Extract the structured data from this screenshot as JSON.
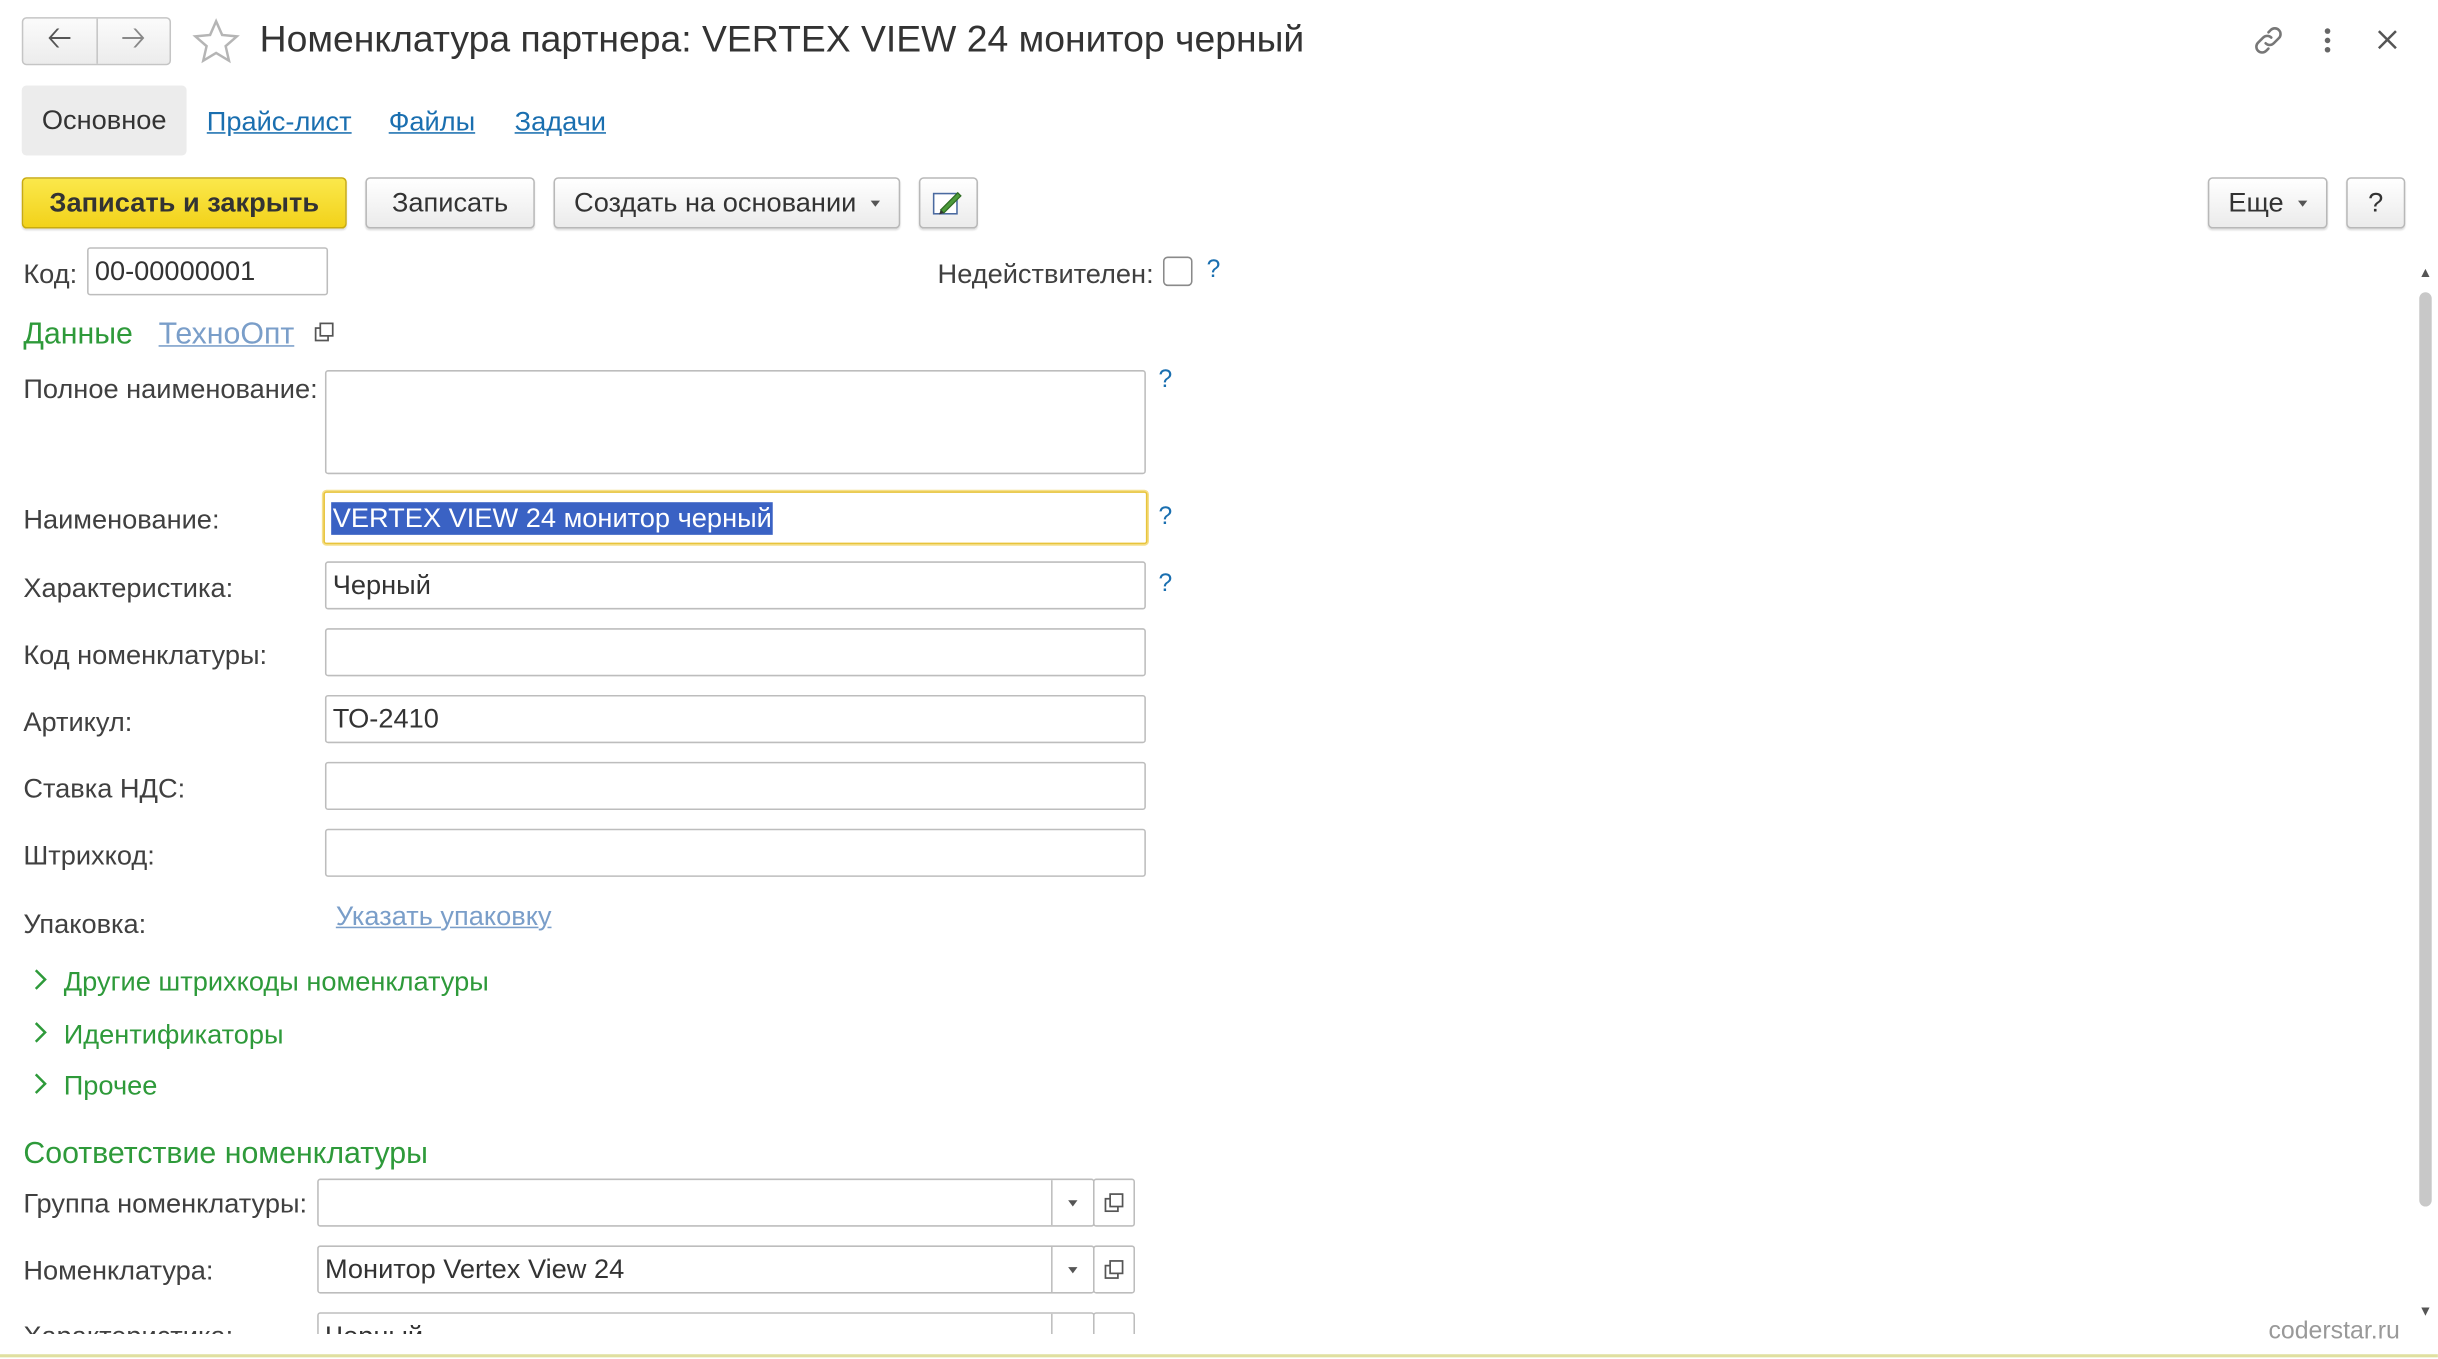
{
  "header": {
    "title": "Номенклатура партнера: VERTEX VIEW 24 монитор черный"
  },
  "tabs": [
    "Основное",
    "Прайс-лист",
    "Файлы",
    "Задачи"
  ],
  "toolbar": {
    "save_close": "Записать и закрыть",
    "save": "Записать",
    "create_based": "Создать на основании",
    "more": "Еще",
    "help": "?"
  },
  "form": {
    "code_label": "Код:",
    "code_value": "00-00000001",
    "invalid_label": "Недействителен:",
    "help_mark": "?",
    "section_data": "Данные",
    "partner_link": "ТехноОпт",
    "full_name_label": "Полное наименование:",
    "full_name_value": "",
    "name_label": "Наименование:",
    "name_value": "VERTEX VIEW 24 монитор черный",
    "characteristic_label": "Характеристика:",
    "characteristic_value": "Черный",
    "nomenclature_code_label": "Код номенклатуры:",
    "nomenclature_code_value": "",
    "article_label": "Артикул:",
    "article_value": "ТО-2410",
    "vat_label": "Ставка НДС:",
    "vat_value": "",
    "barcode_label": "Штрихкод:",
    "barcode_value": "",
    "package_label": "Упаковка:",
    "package_link": "Указать упаковку",
    "groups": [
      "Другие штрихкоды номенклатуры",
      "Идентификаторы",
      "Прочее"
    ],
    "mapping_title": "Соответствие номенклатуры",
    "group_label": "Группа номенклатуры:",
    "group_value": "",
    "nomenclature_label": "Номенклатура:",
    "nomenclature_value": "Монитор Vertex View 24",
    "char2_label": "Характеристика:",
    "char2_value": "Черный"
  },
  "watermark": "coderstar.ru",
  "colors": {
    "primary_button": "#f5d829",
    "link": "#1a6fb0",
    "section": "#2e9a3a",
    "selection": "#3a62c4"
  }
}
